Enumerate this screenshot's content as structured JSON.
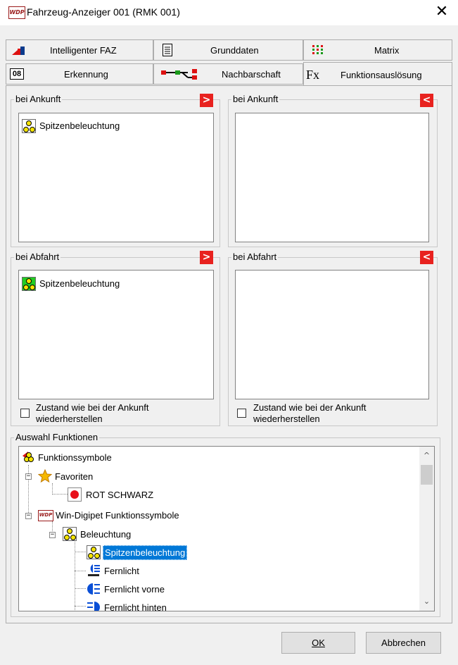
{
  "window": {
    "title": "Fahrzeug-Anzeiger 001 (RMK 001)",
    "logo_text": "WDP",
    "close_glyph": "✕"
  },
  "tabs": {
    "row1": [
      {
        "label": "Intelligenter FAZ",
        "icon": "train-flag-icon"
      },
      {
        "label": "Grunddaten",
        "icon": "document-icon"
      },
      {
        "label": "Matrix",
        "icon": "matrix-icon"
      }
    ],
    "row2": [
      {
        "label": "Erkennung",
        "icon": "badge-08-icon",
        "badge": "08"
      },
      {
        "label": "Nachbarschaft",
        "icon": "network-icon"
      },
      {
        "label": "Funktionsauslösung",
        "icon": "function-fx-icon",
        "fx": "Fx"
      }
    ]
  },
  "panels": {
    "arrival_left": {
      "label": "bei Ankunft",
      "button": ">",
      "items": [
        "Spitzenbeleuchtung"
      ]
    },
    "arrival_right": {
      "label": "bei Ankunft",
      "button": "<",
      "items": []
    },
    "departure_left": {
      "label": "bei Abfahrt",
      "button": ">",
      "items": [
        "Spitzenbeleuchtung"
      ]
    },
    "departure_right": {
      "label": "bei Abfahrt",
      "button": "<",
      "items": []
    },
    "restore_left": {
      "line1": "Zustand wie bei der Ankunft",
      "line2": "wiederherstellen",
      "checked": false
    },
    "restore_right": {
      "line1": "Zustand wie bei der Ankunft",
      "line2": "wiederherstellen",
      "checked": false
    }
  },
  "functions": {
    "label": "Auswahl Funktionen",
    "tree": {
      "root": "Funktionssymbole",
      "favorites": "Favoriten",
      "fav_item": "ROT SCHWARZ",
      "wdp_group": "Win-Digipet Funktionssymbole",
      "lighting": "Beleuchtung",
      "items": [
        "Spitzenbeleuchtung",
        "Fernlicht",
        "Fernlicht vorne",
        "Fernlicht hinten"
      ],
      "selected": "Spitzenbeleuchtung"
    }
  },
  "buttons": {
    "ok": "OK",
    "cancel": "Abbrechen"
  },
  "colors": {
    "accent_red": "#e8221f",
    "selection_blue": "#0078d7",
    "icon_yellow": "#f5e400",
    "icon_green": "#22cc22"
  }
}
